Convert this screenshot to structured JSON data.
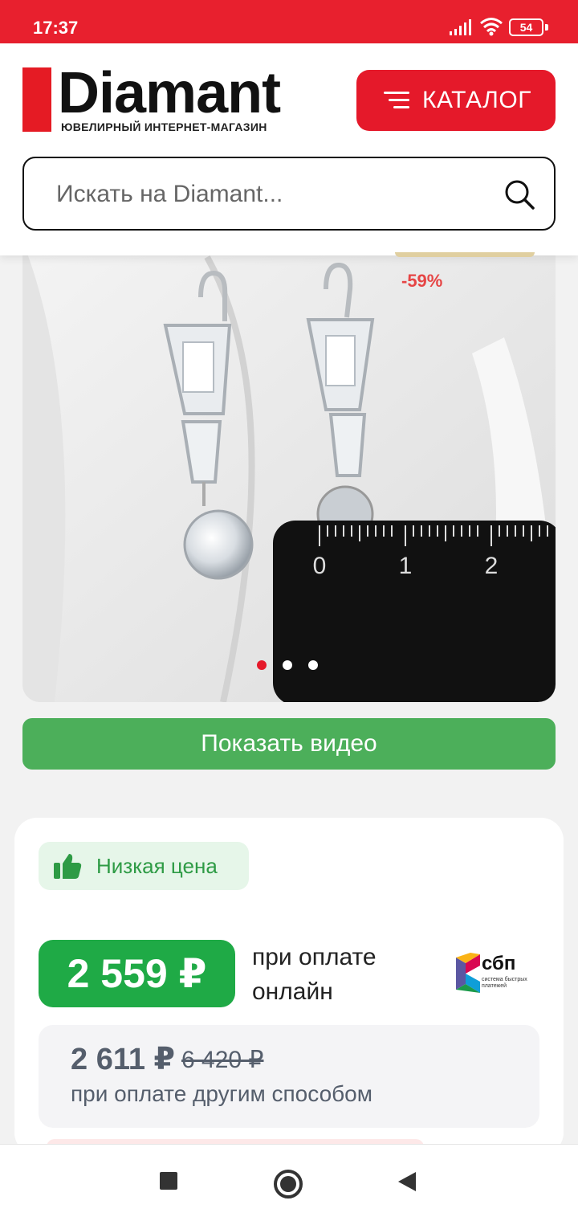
{
  "status_bar": {
    "time": "17:37",
    "battery": "54"
  },
  "header": {
    "logo_word": "Diamant",
    "logo_tagline": "ЮВЕЛИРНЫЙ ИНТЕРНЕТ-МАГАЗИН",
    "catalog_label": "КАТАЛОГ",
    "search_placeholder": "Искать на Diamant..."
  },
  "gallery": {
    "discount": "-59%",
    "ruler_marks": [
      "0",
      "1",
      "2"
    ],
    "slide_count": 3,
    "active_slide": 1
  },
  "video_button": "Показать видео",
  "price": {
    "badge": "Низкая цена",
    "online_price": "2 559 ₽",
    "online_label": "при оплате онлайн",
    "sbp_name": "сбп",
    "sbp_caption": "система быстрых платежей",
    "other_price": "2 611 ₽",
    "old_price": "6 420 ₽",
    "other_label": "при оплате другим способом"
  },
  "colors": {
    "brand_red": "#e5192a",
    "green": "#1faa46",
    "video_green": "#4caf5a"
  }
}
